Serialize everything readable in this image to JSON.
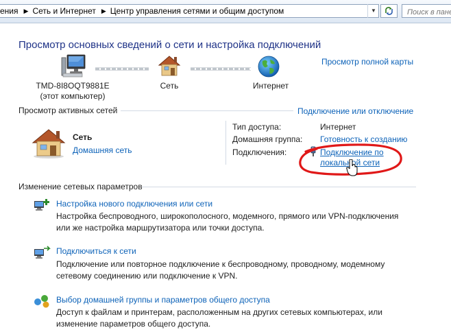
{
  "address_bar": {
    "crumbs": [
      "ения",
      "Сеть и Интернет",
      "Центр управления сетями и общим доступом"
    ],
    "search_placeholder": "Поиск в пане"
  },
  "page": {
    "title": "Просмотр основных сведений о сети и настройка подключений",
    "full_map_link": "Просмотр полной карты"
  },
  "network_map": {
    "computer_name": "TMD-8I8OQT9881E",
    "computer_sub": "(этот компьютер)",
    "network_label": "Сеть",
    "internet_label": "Интернет"
  },
  "active_networks": {
    "heading": "Просмотр активных сетей",
    "connect_link": "Подключение или отключение",
    "network_name": "Сеть",
    "network_type": "Домашняя сеть",
    "access_type_label": "Тип доступа:",
    "access_type_value": "Интернет",
    "homegroup_label": "Домашняя группа:",
    "homegroup_value": "Готовность к созданию",
    "connections_label": "Подключения:",
    "connection_line1": "Подключение по",
    "connection_line2": "локальной сети"
  },
  "settings": {
    "heading": "Изменение сетевых параметров",
    "tasks": [
      {
        "link": "Настройка нового подключения или сети",
        "desc": "Настройка беспроводного, широкополосного, модемного, прямого или VPN-подключения или же настройка маршрутизатора или точки доступа."
      },
      {
        "link": "Подключиться к сети",
        "desc": "Подключение или повторное подключение к беспроводному, проводному, модемному сетевому соединению или подключение к VPN."
      },
      {
        "link": "Выбор домашней группы и параметров общего доступа",
        "desc": "Доступ к файлам и принтерам, расположенным на других сетевых компьютерах, или изменение параметров общего доступа."
      }
    ]
  },
  "colors": {
    "link": "#0c62b8",
    "title": "#1e3287",
    "highlight_annotation": "#e01818"
  }
}
